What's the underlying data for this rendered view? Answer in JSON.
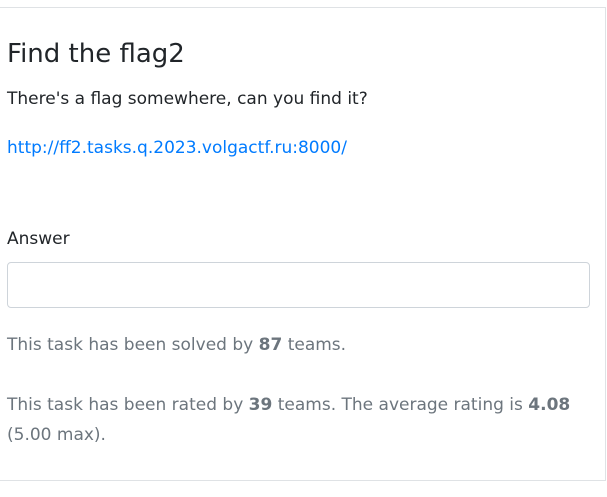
{
  "task": {
    "title": "Find the flag2",
    "description": "There's a flag somewhere, can you find it?",
    "link": "http://ff2.tasks.q.2023.volgactf.ru:8000/"
  },
  "answer": {
    "label": "Answer",
    "value": "",
    "placeholder": ""
  },
  "stats": {
    "solved_prefix": "This task has been solved by ",
    "solved_count": "87",
    "solved_suffix": " teams.",
    "rated_prefix": "This task has been rated by ",
    "rated_count": "39",
    "rated_middle": " teams. The average rating is ",
    "average_rating": "4.08",
    "rated_suffix": " (5.00 max)."
  },
  "colors": {
    "text": "#212529",
    "muted": "#6c757d",
    "link": "#007bff",
    "border": "#ced4da"
  }
}
